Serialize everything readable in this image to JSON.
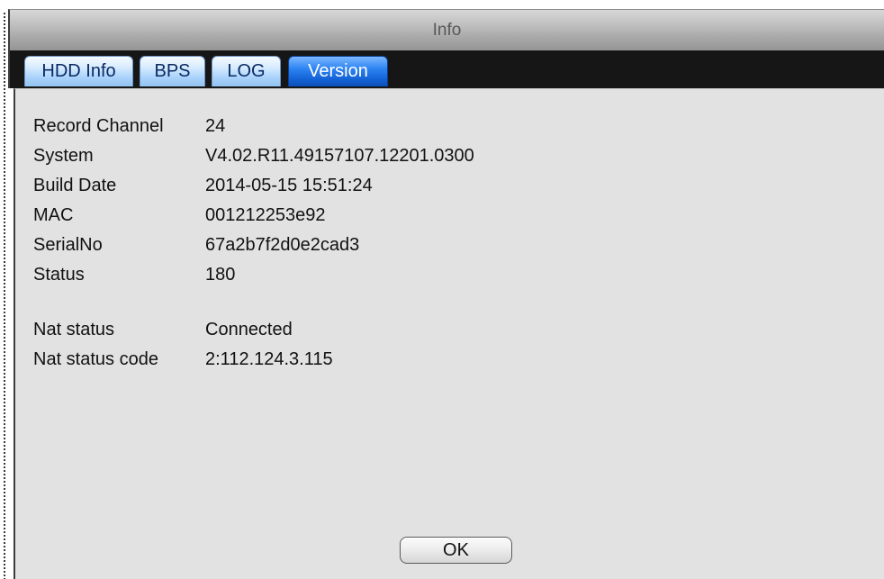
{
  "window": {
    "title": "Info"
  },
  "tabs": [
    {
      "label": "HDD Info",
      "active": false
    },
    {
      "label": "BPS",
      "active": false
    },
    {
      "label": "LOG",
      "active": false
    },
    {
      "label": "Version",
      "active": true
    }
  ],
  "info": {
    "record_channel": {
      "label": "Record Channel",
      "value": "24"
    },
    "system": {
      "label": "System",
      "value": "V4.02.R11.49157107.12201.0300"
    },
    "build_date": {
      "label": "Build Date",
      "value": "2014-05-15 15:51:24"
    },
    "mac": {
      "label": "MAC",
      "value": "001212253e92"
    },
    "serial_no": {
      "label": "SerialNo",
      "value": "67a2b7f2d0e2cad3"
    },
    "status": {
      "label": "Status",
      "value": "180"
    },
    "nat_status": {
      "label": "Nat status",
      "value": "Connected"
    },
    "nat_status_code": {
      "label": "Nat status code",
      "value": "2:112.124.3.115"
    }
  },
  "buttons": {
    "ok_label": "OK"
  },
  "colors": {
    "active_tab": "#1463d6",
    "inactive_tab": "#a9d2fb",
    "tab_strip": "#161616",
    "content_bg": "#e2e2e2"
  }
}
